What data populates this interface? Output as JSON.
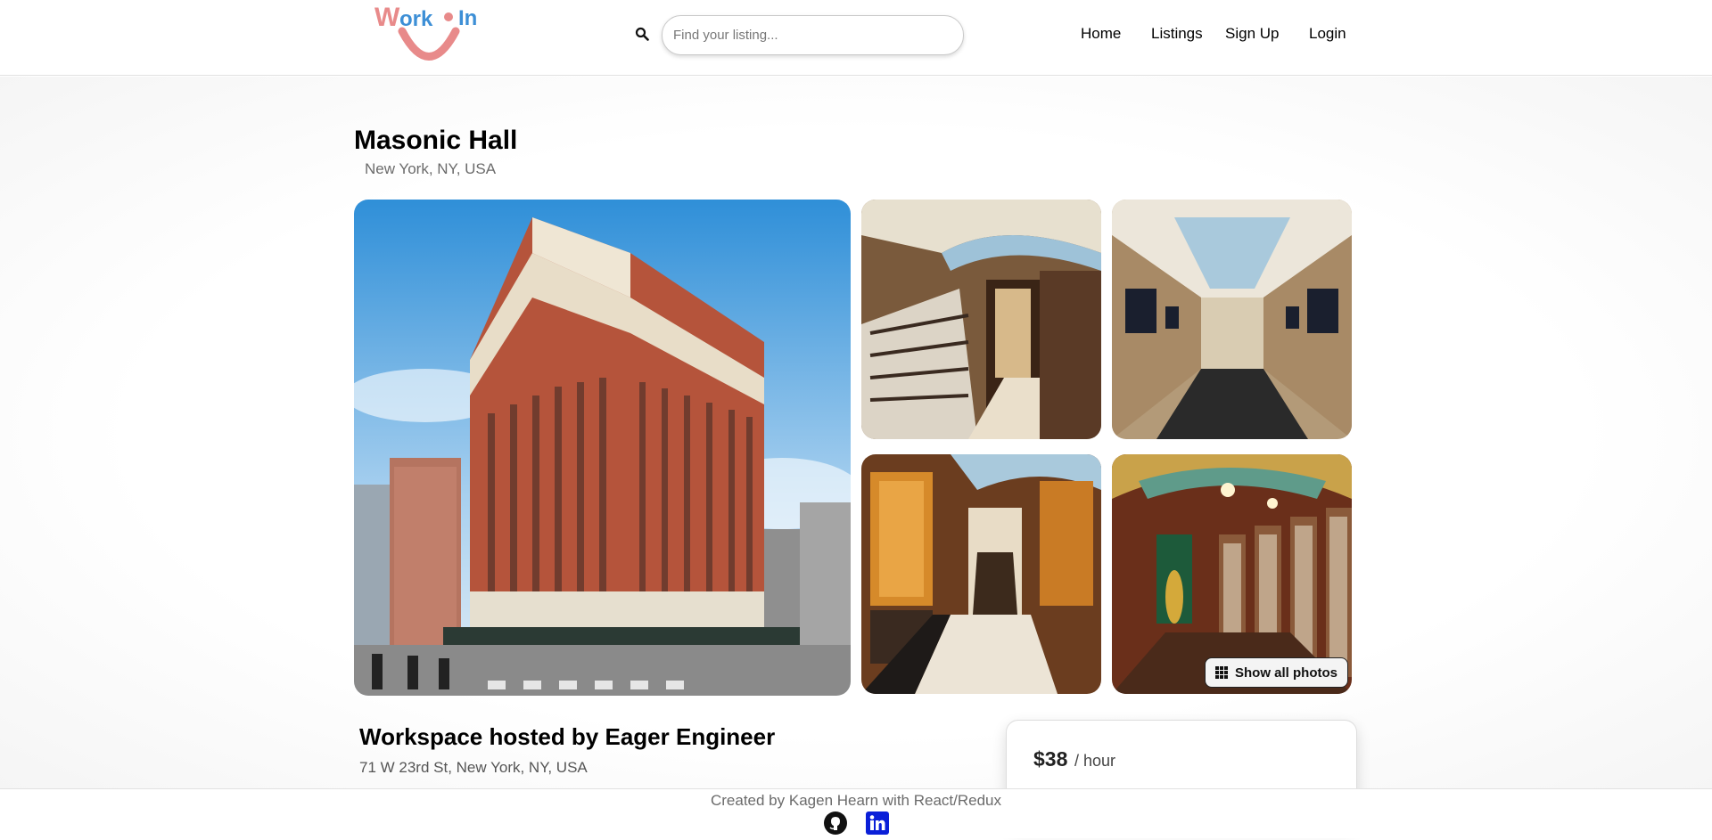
{
  "header": {
    "logo_text": "Work In",
    "search": {
      "placeholder": "Find your listing...",
      "value": ""
    },
    "nav": [
      {
        "label": "Home"
      },
      {
        "label": "Listings"
      },
      {
        "label": "Sign Up"
      },
      {
        "label": "Login"
      }
    ]
  },
  "listing": {
    "title": "Masonic Hall",
    "location": "New York, NY, USA",
    "photos": [
      {
        "alt": "building-exterior"
      },
      {
        "alt": "lobby-staircase"
      },
      {
        "alt": "corridor"
      },
      {
        "alt": "elevator-hall"
      },
      {
        "alt": "library-hall"
      }
    ],
    "show_all_label": "Show all photos",
    "host_title": "Workspace hosted by Eager Engineer",
    "address": "71 W 23rd St, New York, NY, USA",
    "price": "$38",
    "price_unit": "/ hour"
  },
  "footer": {
    "credit": "Created by Kagen Hearn with React/Redux",
    "icons": [
      "github-icon",
      "linkedin-icon"
    ]
  },
  "colors": {
    "logo_red": "#e88a8a",
    "logo_blue": "#3d8fd6",
    "linkedin_blue": "#0a1fd8"
  }
}
